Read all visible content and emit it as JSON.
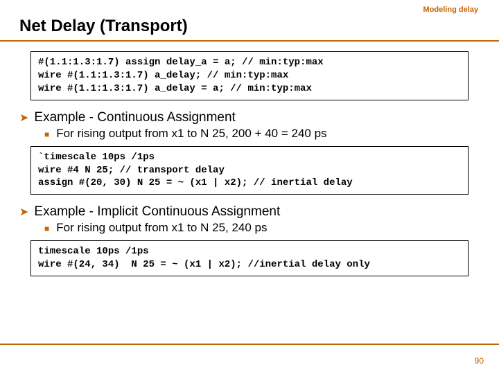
{
  "header": {
    "label": "Modeling delay"
  },
  "title": "Net Delay (Transport)",
  "code1": "#(1.1:1.3:1.7) assign delay_a = a; // min:typ:max\nwire #(1.1:1.3:1.7) a_delay; // min:typ:max\nwire #(1.1:1.3:1.7) a_delay = a; // min:typ:max",
  "b1": "Example - Continuous Assignment",
  "b1s": "For rising output from x1 to N 25, 200 + 40  = 240 ps",
  "code2": "`timescale 10ps /1ps\nwire #4 N 25; // transport delay\nassign #(20, 30) N 25 = ~ (x1 | x2); // inertial delay",
  "b2": "Example - Implicit Continuous Assignment",
  "b2s": "For rising output from x1 to N 25, 240 ps",
  "code3": "timescale 10ps /1ps\nwire #(24, 34)  N 25 = ~ (x1 | x2); //inertial delay only",
  "pagenum": "90"
}
